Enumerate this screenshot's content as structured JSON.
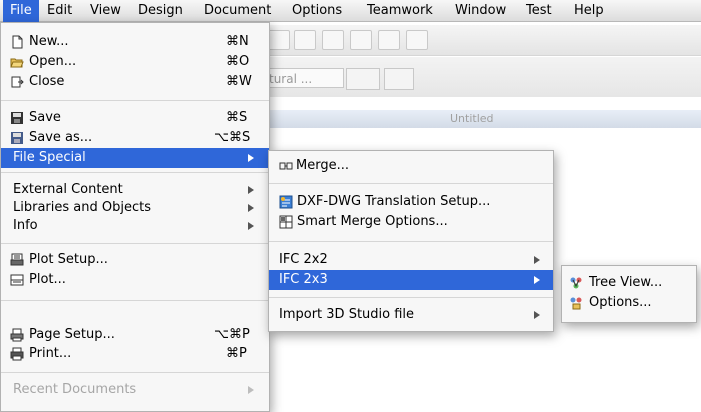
{
  "menubar": {
    "items": [
      "File",
      "Edit",
      "View",
      "Design",
      "Document",
      "Options",
      "Teamwork",
      "Window",
      "Test",
      "Help"
    ]
  },
  "background": {
    "select_text": "tural ...",
    "tab_text": "Untitled"
  },
  "file_menu": {
    "items": [
      {
        "label": "New...",
        "shortcut": "⌘N",
        "icon": "new-document-icon"
      },
      {
        "label": "Open...",
        "shortcut": "⌘O",
        "icon": "open-folder-icon"
      },
      {
        "label": "Close",
        "shortcut": "⌘W",
        "icon": "close-document-icon"
      },
      {
        "label": "Save",
        "shortcut": "⌘S",
        "icon": "save-disk-icon"
      },
      {
        "label": "Save as...",
        "shortcut": "⌥⌘S",
        "icon": "save-as-icon"
      },
      {
        "label": "File Special",
        "submenu": true,
        "highlighted": true
      },
      {
        "label": "External Content",
        "submenu": true
      },
      {
        "label": "Libraries and Objects",
        "submenu": true
      },
      {
        "label": "Info",
        "submenu": true
      },
      {
        "label": "Plot Setup...",
        "icon": "plot-setup-icon"
      },
      {
        "label": "Plot...",
        "icon": "plotter-icon"
      },
      {
        "label": "Page Setup...",
        "shortcut": "⌥⌘P",
        "icon": "page-setup-icon"
      },
      {
        "label": "Print...",
        "shortcut": "⌘P",
        "icon": "printer-icon"
      },
      {
        "label": "Recent Documents",
        "submenu": true,
        "disabled": true
      }
    ]
  },
  "file_special_menu": {
    "items": [
      {
        "label": "Merge...",
        "icon": "merge-icon"
      },
      {
        "label": "DXF-DWG Translation Setup...",
        "icon": "dxf-dwg-icon"
      },
      {
        "label": "Smart Merge Options...",
        "icon": "smart-merge-icon"
      },
      {
        "label": "IFC 2x2",
        "submenu": true
      },
      {
        "label": "IFC 2x3",
        "submenu": true,
        "highlighted": true
      },
      {
        "label": "Import 3D Studio file",
        "submenu": true
      }
    ]
  },
  "ifc_menu": {
    "items": [
      {
        "label": "Tree View...",
        "icon": "tree-view-icon"
      },
      {
        "label": "Options...",
        "icon": "ifc-options-icon"
      }
    ]
  },
  "colors": {
    "highlight": "#2f67d9",
    "menu_bg": "#f7f7f7",
    "disabled_text": "#a6a6a6"
  }
}
